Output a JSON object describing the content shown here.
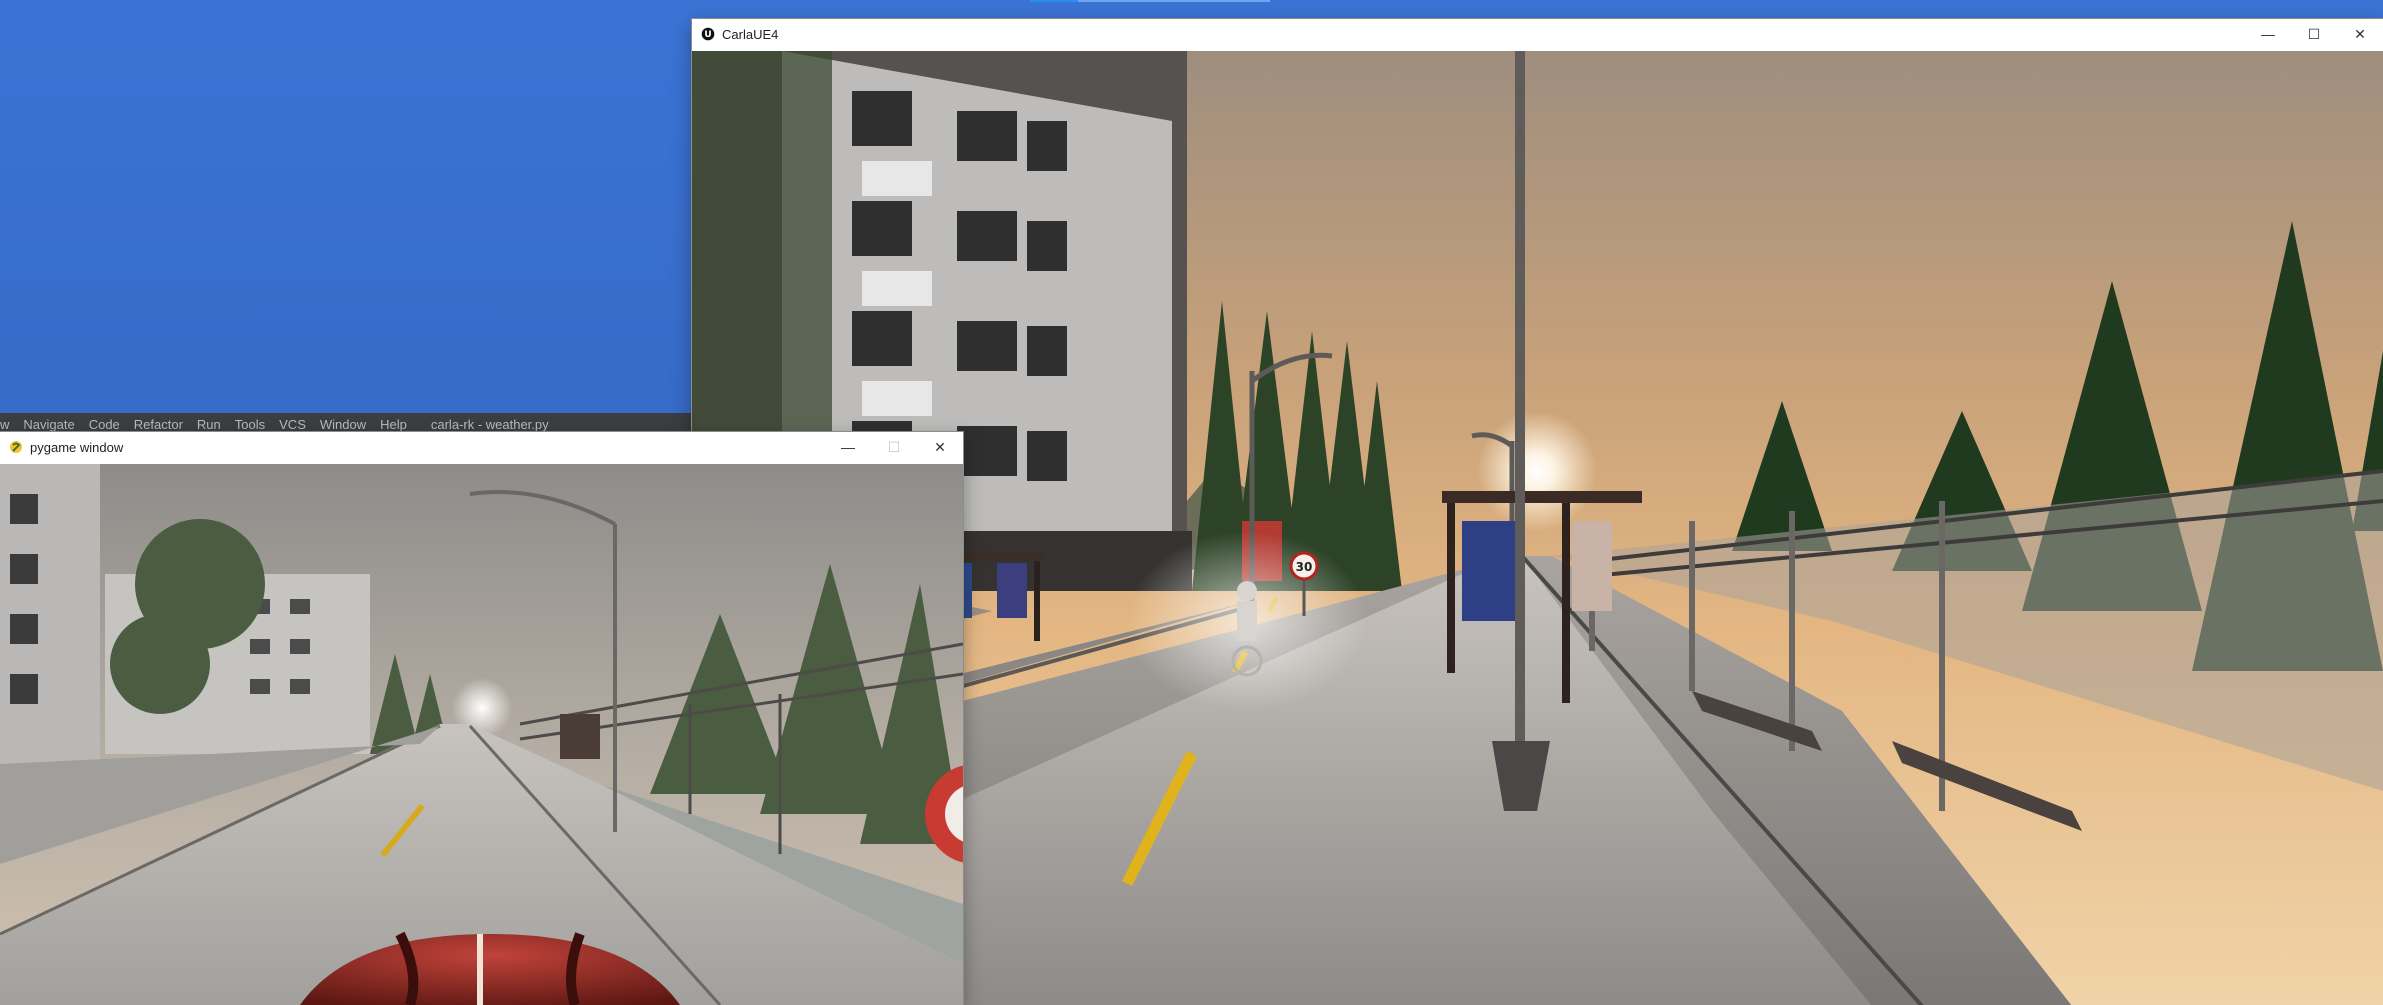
{
  "ide": {
    "menu": [
      "w",
      "Navigate",
      "Code",
      "Refactor",
      "Run",
      "Tools",
      "VCS",
      "Window",
      "Help"
    ],
    "breadcrumb": "carla-rk - weather.py"
  },
  "carla_window": {
    "title": "CarlaUE4",
    "icon": "unreal-engine-icon",
    "controls": {
      "minimize": "—",
      "maximize": "☐",
      "close": "✕"
    },
    "scene": {
      "speed_sign": "30"
    }
  },
  "pygame_window": {
    "title": "pygame window",
    "icon": "pygame-snake-icon",
    "controls": {
      "minimize": "—",
      "maximize": "☐",
      "close": "✕"
    }
  },
  "colors": {
    "desktop": "#3a6fcf",
    "sky_warm": "#d9a774",
    "sky_pygame": "#b4aca0",
    "road": "#9a9896",
    "center_line": "#e0b21c"
  }
}
